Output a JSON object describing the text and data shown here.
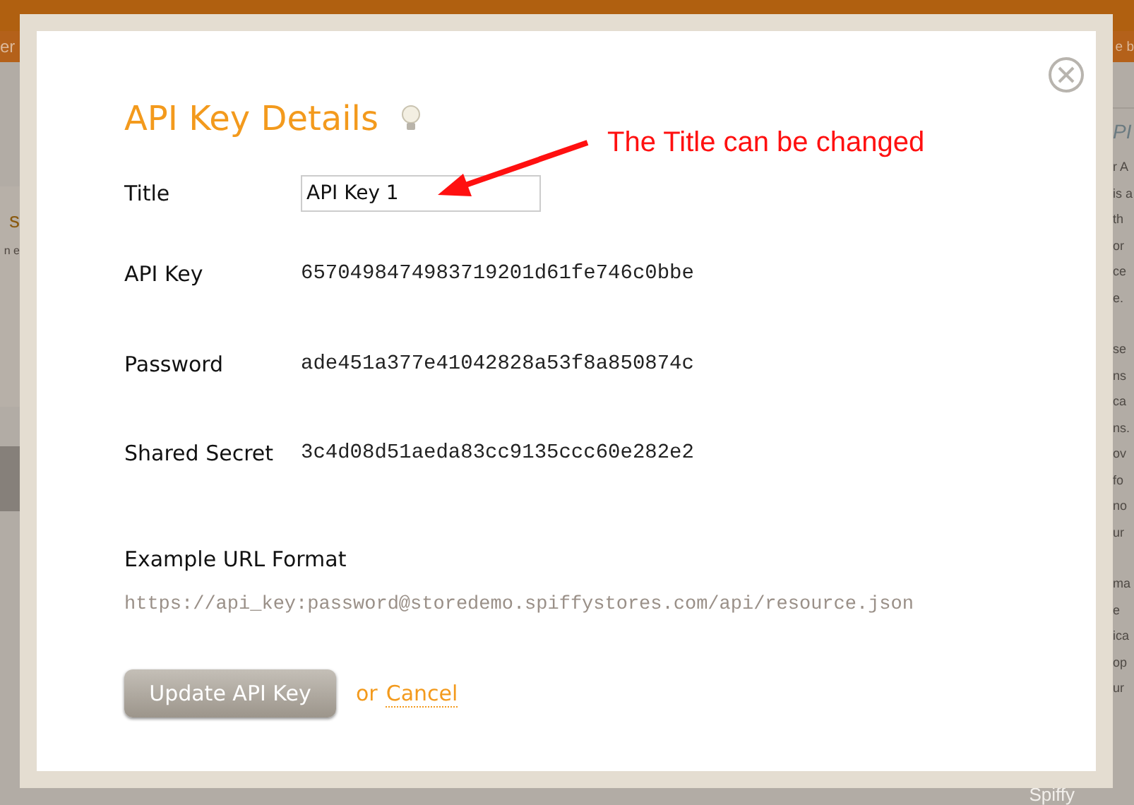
{
  "background": {
    "top_bar_left": "er",
    "top_bar_right": "e b",
    "left_panel": {
      "heading": "s",
      "text": "n e"
    },
    "right_panel": {
      "heading": "PI",
      "paragraphs": [
        [
          "r A",
          "is a",
          "th",
          "or",
          "ce",
          "e."
        ],
        [
          "se",
          "ns",
          "ca",
          "ns.",
          "ov",
          "fo",
          "no",
          "ur"
        ],
        [
          "ma",
          "e",
          "ica",
          "op",
          "ur"
        ]
      ]
    },
    "footer_logo": "Spiffy"
  },
  "dialog": {
    "title": "API Key Details",
    "fields": [
      {
        "label": "Title",
        "kind": "input",
        "value": "API Key 1"
      },
      {
        "label": "API Key",
        "kind": "text",
        "value": "6570498474983719201d61fe746c0bbe"
      },
      {
        "label": "Password",
        "kind": "text",
        "value": "ade451a377e41042828a53f8a850874c"
      },
      {
        "label": "Shared Secret",
        "kind": "text",
        "value": "3c4d08d51aeda83cc9135ccc60e282e2"
      }
    ],
    "example": {
      "label": "Example URL Format",
      "url": "https://api_key:password@storedemo.spiffystores.com/api/resource.json"
    },
    "submit": "Update API Key",
    "or": "or",
    "cancel": "Cancel"
  },
  "annotation": {
    "text": "The Title can be changed"
  }
}
